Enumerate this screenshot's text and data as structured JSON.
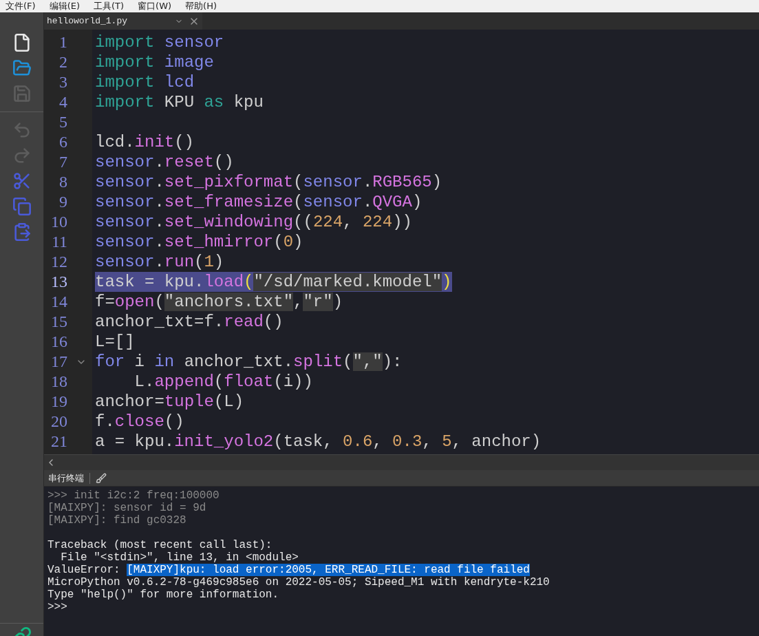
{
  "menu": [
    "文件(F)",
    "编辑(E)",
    "工具(T)",
    "窗口(W)",
    "帮助(H)"
  ],
  "toolbar_groups": [
    [
      {
        "kind": "new",
        "disabled": false
      },
      {
        "kind": "open",
        "disabled": false
      },
      {
        "kind": "save",
        "disabled": true
      }
    ],
    [
      {
        "kind": "undo",
        "disabled": true
      },
      {
        "kind": "redo",
        "disabled": true
      },
      {
        "kind": "cut",
        "disabled": false
      },
      {
        "kind": "copy",
        "disabled": false
      },
      {
        "kind": "paste",
        "disabled": false
      }
    ]
  ],
  "editor": {
    "tab": {
      "label": "helloworld_1.py"
    },
    "lines": [
      {
        "number": "1",
        "current": false,
        "foldable": false,
        "tokens": [
          {
            "t": "import",
            "kind": "keyword"
          },
          {
            "t": " sensor",
            "kind": "name"
          }
        ]
      },
      {
        "number": "2",
        "current": false,
        "foldable": false,
        "tokens": [
          {
            "t": "import",
            "kind": "keyword"
          },
          {
            "t": " image",
            "kind": "name"
          }
        ]
      },
      {
        "number": "3",
        "current": false,
        "foldable": false,
        "tokens": [
          {
            "t": "import",
            "kind": "keyword"
          },
          {
            "t": " lcd",
            "kind": "name"
          }
        ]
      },
      {
        "number": "4",
        "current": false,
        "foldable": false,
        "tokens": [
          {
            "t": "import",
            "kind": "keyword"
          },
          {
            "t": " KPU ",
            "kind": "plain"
          },
          {
            "t": "as",
            "kind": "keyword"
          },
          {
            "t": " kpu",
            "kind": "plain"
          }
        ]
      },
      {
        "number": "5",
        "current": false,
        "foldable": false
      },
      {
        "number": "6",
        "current": false,
        "foldable": false,
        "tokens": [
          {
            "t": "lcd.",
            "kind": "plain"
          },
          {
            "t": "init",
            "kind": "call"
          },
          {
            "t": "()",
            "kind": "plain"
          }
        ]
      },
      {
        "number": "7",
        "current": false,
        "foldable": false,
        "tokens": [
          {
            "t": "sensor",
            "kind": "name"
          },
          {
            "t": ".",
            "kind": "plain"
          },
          {
            "t": "reset",
            "kind": "call"
          },
          {
            "t": "()",
            "kind": "plain"
          }
        ]
      },
      {
        "number": "8",
        "current": false,
        "foldable": false,
        "tokens": [
          {
            "t": "sensor",
            "kind": "name"
          },
          {
            "t": ".",
            "kind": "plain"
          },
          {
            "t": "set_pixformat",
            "kind": "call"
          },
          {
            "t": "(",
            "kind": "plain"
          },
          {
            "t": "sensor",
            "kind": "name"
          },
          {
            "t": ".",
            "kind": "plain"
          },
          {
            "t": "RGB565",
            "kind": "call"
          },
          {
            "t": ")",
            "kind": "plain"
          }
        ]
      },
      {
        "number": "9",
        "current": false,
        "foldable": false,
        "tokens": [
          {
            "t": "sensor",
            "kind": "name"
          },
          {
            "t": ".",
            "kind": "plain"
          },
          {
            "t": "set_framesize",
            "kind": "call"
          },
          {
            "t": "(",
            "kind": "plain"
          },
          {
            "t": "sensor",
            "kind": "name"
          },
          {
            "t": ".",
            "kind": "plain"
          },
          {
            "t": "QVGA",
            "kind": "call"
          },
          {
            "t": ")",
            "kind": "plain"
          }
        ]
      },
      {
        "number": "10",
        "current": false,
        "foldable": false,
        "tokens": [
          {
            "t": "sensor",
            "kind": "name"
          },
          {
            "t": ".",
            "kind": "plain"
          },
          {
            "t": "set_windowing",
            "kind": "call"
          },
          {
            "t": "((",
            "kind": "plain"
          },
          {
            "t": "224",
            "kind": "number"
          },
          {
            "t": ", ",
            "kind": "plain"
          },
          {
            "t": "224",
            "kind": "number"
          },
          {
            "t": "))",
            "kind": "plain"
          }
        ]
      },
      {
        "number": "11",
        "current": false,
        "foldable": false,
        "tokens": [
          {
            "t": "sensor",
            "kind": "name"
          },
          {
            "t": ".",
            "kind": "plain"
          },
          {
            "t": "set_hmirror",
            "kind": "call"
          },
          {
            "t": "(",
            "kind": "plain"
          },
          {
            "t": "0",
            "kind": "number"
          },
          {
            "t": ")",
            "kind": "plain"
          }
        ]
      },
      {
        "number": "12",
        "current": false,
        "foldable": false,
        "tokens": [
          {
            "t": "sensor",
            "kind": "name"
          },
          {
            "t": ".",
            "kind": "plain"
          },
          {
            "t": "run",
            "kind": "call"
          },
          {
            "t": "(",
            "kind": "plain"
          },
          {
            "t": "1",
            "kind": "number"
          },
          {
            "t": ")",
            "kind": "plain"
          }
        ]
      },
      {
        "number": "13",
        "current": true,
        "foldable": false,
        "tokens": [
          {
            "t": "task = kpu.",
            "kind": "plain"
          },
          {
            "t": "load",
            "kind": "call"
          },
          {
            "t": "(",
            "kind": "bracket"
          },
          {
            "t": "\"/sd/marked.kmodel\"",
            "kind": "string"
          },
          {
            "t": ")",
            "kind": "bracket"
          }
        ]
      },
      {
        "number": "14",
        "current": false,
        "foldable": false,
        "tokens": [
          {
            "t": "f=",
            "kind": "plain"
          },
          {
            "t": "open",
            "kind": "call"
          },
          {
            "t": "(",
            "kind": "plain"
          },
          {
            "t": "\"anchors.txt\"",
            "kind": "string"
          },
          {
            "t": ",",
            "kind": "plain"
          },
          {
            "t": "\"r\"",
            "kind": "string"
          },
          {
            "t": ")",
            "kind": "plain"
          }
        ]
      },
      {
        "number": "15",
        "current": false,
        "foldable": false,
        "tokens": [
          {
            "t": "anchor_txt=f.",
            "kind": "plain"
          },
          {
            "t": "read",
            "kind": "call"
          },
          {
            "t": "()",
            "kind": "plain"
          }
        ]
      },
      {
        "number": "16",
        "current": false,
        "foldable": false,
        "tokens": [
          {
            "t": "L=[]",
            "kind": "plain"
          }
        ]
      },
      {
        "number": "17",
        "current": false,
        "foldable": true,
        "tokens": [
          {
            "t": "for",
            "kind": "name"
          },
          {
            "t": " i ",
            "kind": "plain"
          },
          {
            "t": "in",
            "kind": "name"
          },
          {
            "t": " anchor_txt.",
            "kind": "plain"
          },
          {
            "t": "split",
            "kind": "call"
          },
          {
            "t": "(",
            "kind": "plain"
          },
          {
            "t": "\",\"",
            "kind": "string"
          },
          {
            "t": "):",
            "kind": "plain"
          }
        ]
      },
      {
        "number": "18",
        "current": false,
        "foldable": false,
        "tokens": [
          {
            "t": "    L.",
            "kind": "plain"
          },
          {
            "t": "append",
            "kind": "call"
          },
          {
            "t": "(",
            "kind": "plain"
          },
          {
            "t": "float",
            "kind": "call"
          },
          {
            "t": "(i))",
            "kind": "plain"
          }
        ]
      },
      {
        "number": "19",
        "current": false,
        "foldable": false,
        "tokens": [
          {
            "t": "anchor=",
            "kind": "plain"
          },
          {
            "t": "tuple",
            "kind": "call"
          },
          {
            "t": "(L)",
            "kind": "plain"
          }
        ]
      },
      {
        "number": "20",
        "current": false,
        "foldable": false,
        "tokens": [
          {
            "t": "f.",
            "kind": "plain"
          },
          {
            "t": "close",
            "kind": "call"
          },
          {
            "t": "()",
            "kind": "plain"
          }
        ]
      },
      {
        "number": "21",
        "current": false,
        "foldable": false,
        "tokens": [
          {
            "t": "a = kpu.",
            "kind": "plain"
          },
          {
            "t": "init_yolo2",
            "kind": "call"
          },
          {
            "t": "(task, ",
            "kind": "plain"
          },
          {
            "t": "0.6",
            "kind": "number"
          },
          {
            "t": ", ",
            "kind": "plain"
          },
          {
            "t": "0.3",
            "kind": "number"
          },
          {
            "t": ", ",
            "kind": "plain"
          },
          {
            "t": "5",
            "kind": "number"
          },
          {
            "t": ", anchor)",
            "kind": "plain"
          }
        ]
      }
    ]
  },
  "terminal": {
    "title": "串行终端",
    "lines": [
      {
        "kind": "log",
        "text": ">>> init i2c:2 freq:100000"
      },
      {
        "kind": "log",
        "text": "[MAIXPY]: sensor id = 9d"
      },
      {
        "kind": "log",
        "text": "[MAIXPY]: find gc0328"
      },
      {
        "kind": "blank"
      },
      {
        "kind": "output",
        "text": "Traceback (most recent call last):"
      },
      {
        "kind": "output",
        "text": "  File \"<stdin>\", line 13, in <module>"
      },
      {
        "kind": "output",
        "text": "ValueError: ",
        "selection": "[MAIXPY]kpu: load error:2005, ERR_READ_FILE: read file failed"
      },
      {
        "kind": "output",
        "text": "MicroPython v0.6.2-78-g469c985e6 on 2022-05-05; Sipeed_M1 with kendryte-k210"
      },
      {
        "kind": "output",
        "text": "Type \"help()\" for more information."
      },
      {
        "kind": "output",
        "text": ">>>"
      }
    ]
  }
}
